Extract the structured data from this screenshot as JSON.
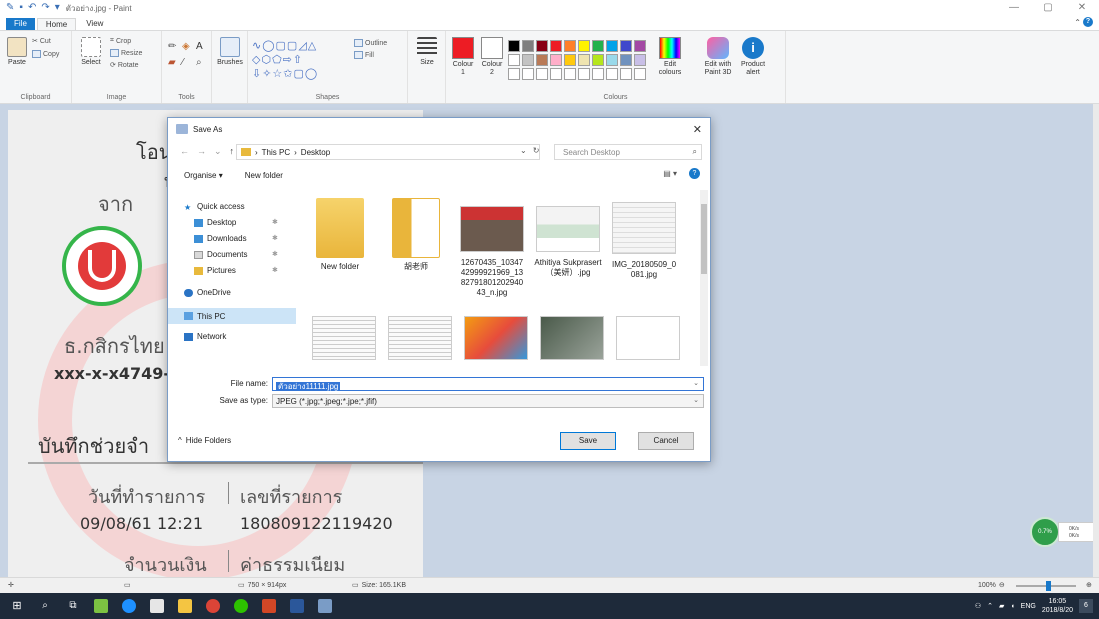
{
  "window": {
    "title": "ตัวอย่าง.jpg - Paint",
    "icons": [
      "paint-icon",
      "save-icon",
      "undo-icon",
      "redo-icon"
    ],
    "controls": [
      "—",
      "▢",
      "✕"
    ]
  },
  "ribbon_tabs": {
    "file": "File",
    "home": "Home",
    "view": "View"
  },
  "ribbon": {
    "clipboard": {
      "paste": "Paste",
      "cut": "Cut",
      "copy": "Copy",
      "label": "Clipboard"
    },
    "image": {
      "select": "Select",
      "crop": "Crop",
      "resize": "Resize",
      "rotate": "Rotate",
      "label": "Image"
    },
    "tools": {
      "label": "Tools"
    },
    "brushes": "Brushes",
    "shapes": {
      "outline": "Outline",
      "fill": "Fill",
      "label": "Shapes"
    },
    "size": "Size",
    "colour1": "Colour 1",
    "colour2": "Colour 2",
    "colours_label": "Colours",
    "edit_colours": "Edit colours",
    "edit_paint3d": "Edit with Paint 3D",
    "product_alert": "Product alert",
    "palette": [
      "#000000",
      "#7f7f7f",
      "#880015",
      "#ed1c24",
      "#ff7f27",
      "#fff200",
      "#22b14c",
      "#00a2e8",
      "#3f48cc",
      "#a349a4",
      "#ffffff",
      "#c3c3c3",
      "#b97a57",
      "#ffaec9",
      "#ffc90e",
      "#efe4b0",
      "#b5e61d",
      "#99d9ea",
      "#7092be",
      "#c8bfe7",
      "#ffffff",
      "#ffffff",
      "#ffffff",
      "#ffffff",
      "#ffffff",
      "#ffffff",
      "#ffffff",
      "#ffffff",
      "#ffffff",
      "#ffffff"
    ],
    "colour1_hex": "#ed1c24",
    "colour2_hex": "#ffffff"
  },
  "document": {
    "heading": "โอน",
    "heading2": "ท",
    "from": "จาก",
    "bank": "ธ.กสิกรไทย",
    "account": "xxx-x-x4749-",
    "memo": "บันทึกช่วยจำ",
    "date_label": "วันที่ทำรายการ",
    "ref_label": "เลขที่รายการ",
    "date_value": "09/08/61 12:21",
    "ref_value": "180809122119420",
    "amount_label": "จำนวนเงิน",
    "fee_label": "ค่าธรรมเนียม"
  },
  "dialog": {
    "title": "Save As",
    "breadcrumb": [
      "This PC",
      "Desktop"
    ],
    "search_placeholder": "Search Desktop",
    "organise": "Organise",
    "new_folder": "New folder",
    "nav": [
      {
        "label": "Quick access",
        "icon": "star-icon"
      },
      {
        "label": "Desktop",
        "icon": "desktop-icon"
      },
      {
        "label": "Downloads",
        "icon": "downloads-icon"
      },
      {
        "label": "Documents",
        "icon": "documents-icon"
      },
      {
        "label": "Pictures",
        "icon": "pictures-icon"
      },
      {
        "label": "OneDrive",
        "icon": "cloud-icon"
      },
      {
        "label": "This PC",
        "icon": "computer-icon"
      },
      {
        "label": "Network",
        "icon": "network-icon"
      }
    ],
    "files": [
      {
        "name": "New folder",
        "kind": "folder"
      },
      {
        "name": "胡老师",
        "kind": "folder"
      },
      {
        "name": "12670435_10347 42999921969_13 82791801202940 43_n.jpg",
        "kind": "photo"
      },
      {
        "name": "Athitiya Sukprasert（美妍）.jpg",
        "kind": "photo"
      },
      {
        "name": "IMG_20180509_0 081.jpg",
        "kind": "photo"
      }
    ],
    "file_name_label": "File name:",
    "file_name_value": "ตัวอย่าง11111.jpg",
    "save_type_label": "Save as type:",
    "save_type_value": "JPEG (*.jpg;*.jpeg;*.jpe;*.jfif)",
    "hide_folders": "Hide Folders",
    "save": "Save",
    "cancel": "Cancel"
  },
  "statusbar": {
    "dimensions": "750 × 914px",
    "size": "Size: 165.1KB",
    "zoom": "100%"
  },
  "widget": {
    "speed_label": "0.7%",
    "up": "0K/s",
    "down": "0K/s"
  },
  "taskbar": {
    "lang": "ENG",
    "time": "16:05",
    "date": "2018/8/20",
    "notifications": "6"
  }
}
